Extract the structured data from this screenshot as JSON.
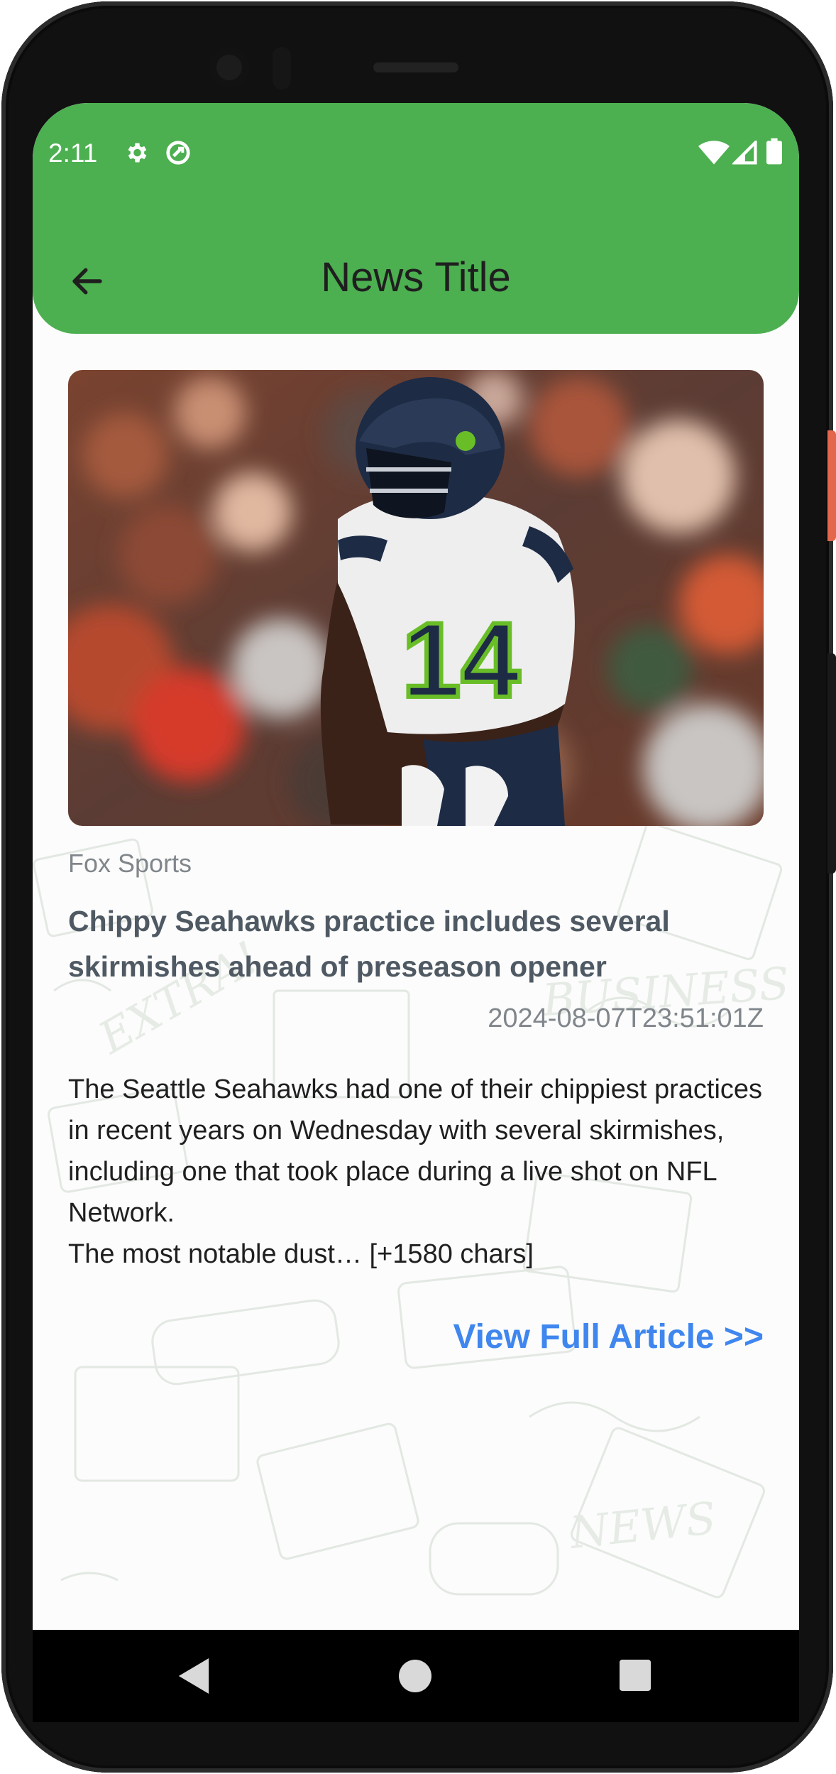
{
  "status_bar": {
    "time": "2:11",
    "left_icons": [
      "gear-icon",
      "sync-icon"
    ],
    "right_icons": [
      "wifi-icon",
      "signal-icon",
      "battery-icon"
    ]
  },
  "app_bar": {
    "title": "News Title",
    "back_icon": "arrow-back-icon",
    "color": "#4caf50"
  },
  "article": {
    "source": "Fox Sports",
    "headline": "Chippy Seahawks practice includes several skirmishes ahead of preseason opener",
    "published_at": "2024-08-07T23:51:01Z",
    "description_lines": [
      "The Seattle Seahawks had one of their chippiest practices in recent years on Wednesday with several skirmishes, including one that took place during a live shot on NFL Network.",
      "The most notable dust… [+1580 chars]"
    ],
    "cta_label": "View Full Article >>",
    "cta_color": "#3f86ee",
    "image_alt": "Seahawks player wearing number 14",
    "jersey_number": "14"
  },
  "nav_bar": {
    "buttons": [
      "back-triangle-icon",
      "home-circle-icon",
      "recents-square-icon"
    ]
  }
}
